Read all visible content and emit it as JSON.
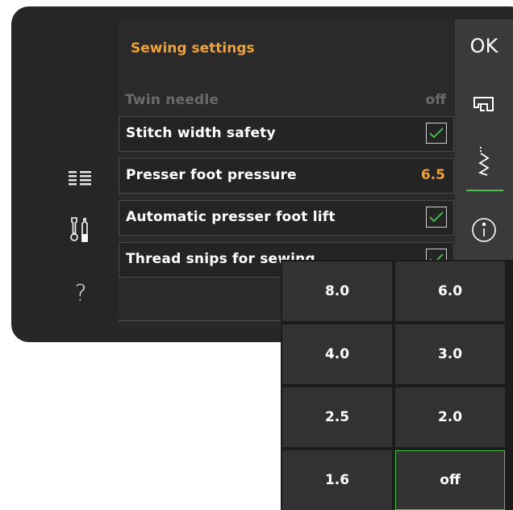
{
  "title": "Sewing settings",
  "rows": [
    {
      "label": "Twin needle",
      "value": "off",
      "disabled": true
    },
    {
      "label": "Stitch width safety",
      "checked": true
    },
    {
      "label": "Presser foot pressure",
      "value": "6.5",
      "value_color": "#f0a038"
    },
    {
      "label": "Automatic presser foot lift",
      "checked": true
    },
    {
      "label": "Thread snips for sewing",
      "checked": true
    }
  ],
  "left_icons": [
    "list-icon",
    "tools-icon",
    "help-icon"
  ],
  "help_glyph": "?",
  "right_bar": {
    "ok_label": "OK",
    "icons": [
      "sewing-machine-icon",
      "stitch-icon",
      "info-icon"
    ]
  },
  "popup": {
    "options": [
      "8.0",
      "6.0",
      "4.0",
      "3.0",
      "2.5",
      "2.0",
      "1.6",
      "off"
    ],
    "selected": "off"
  },
  "colors": {
    "accent": "#f0a038",
    "check": "#4fc24f"
  }
}
